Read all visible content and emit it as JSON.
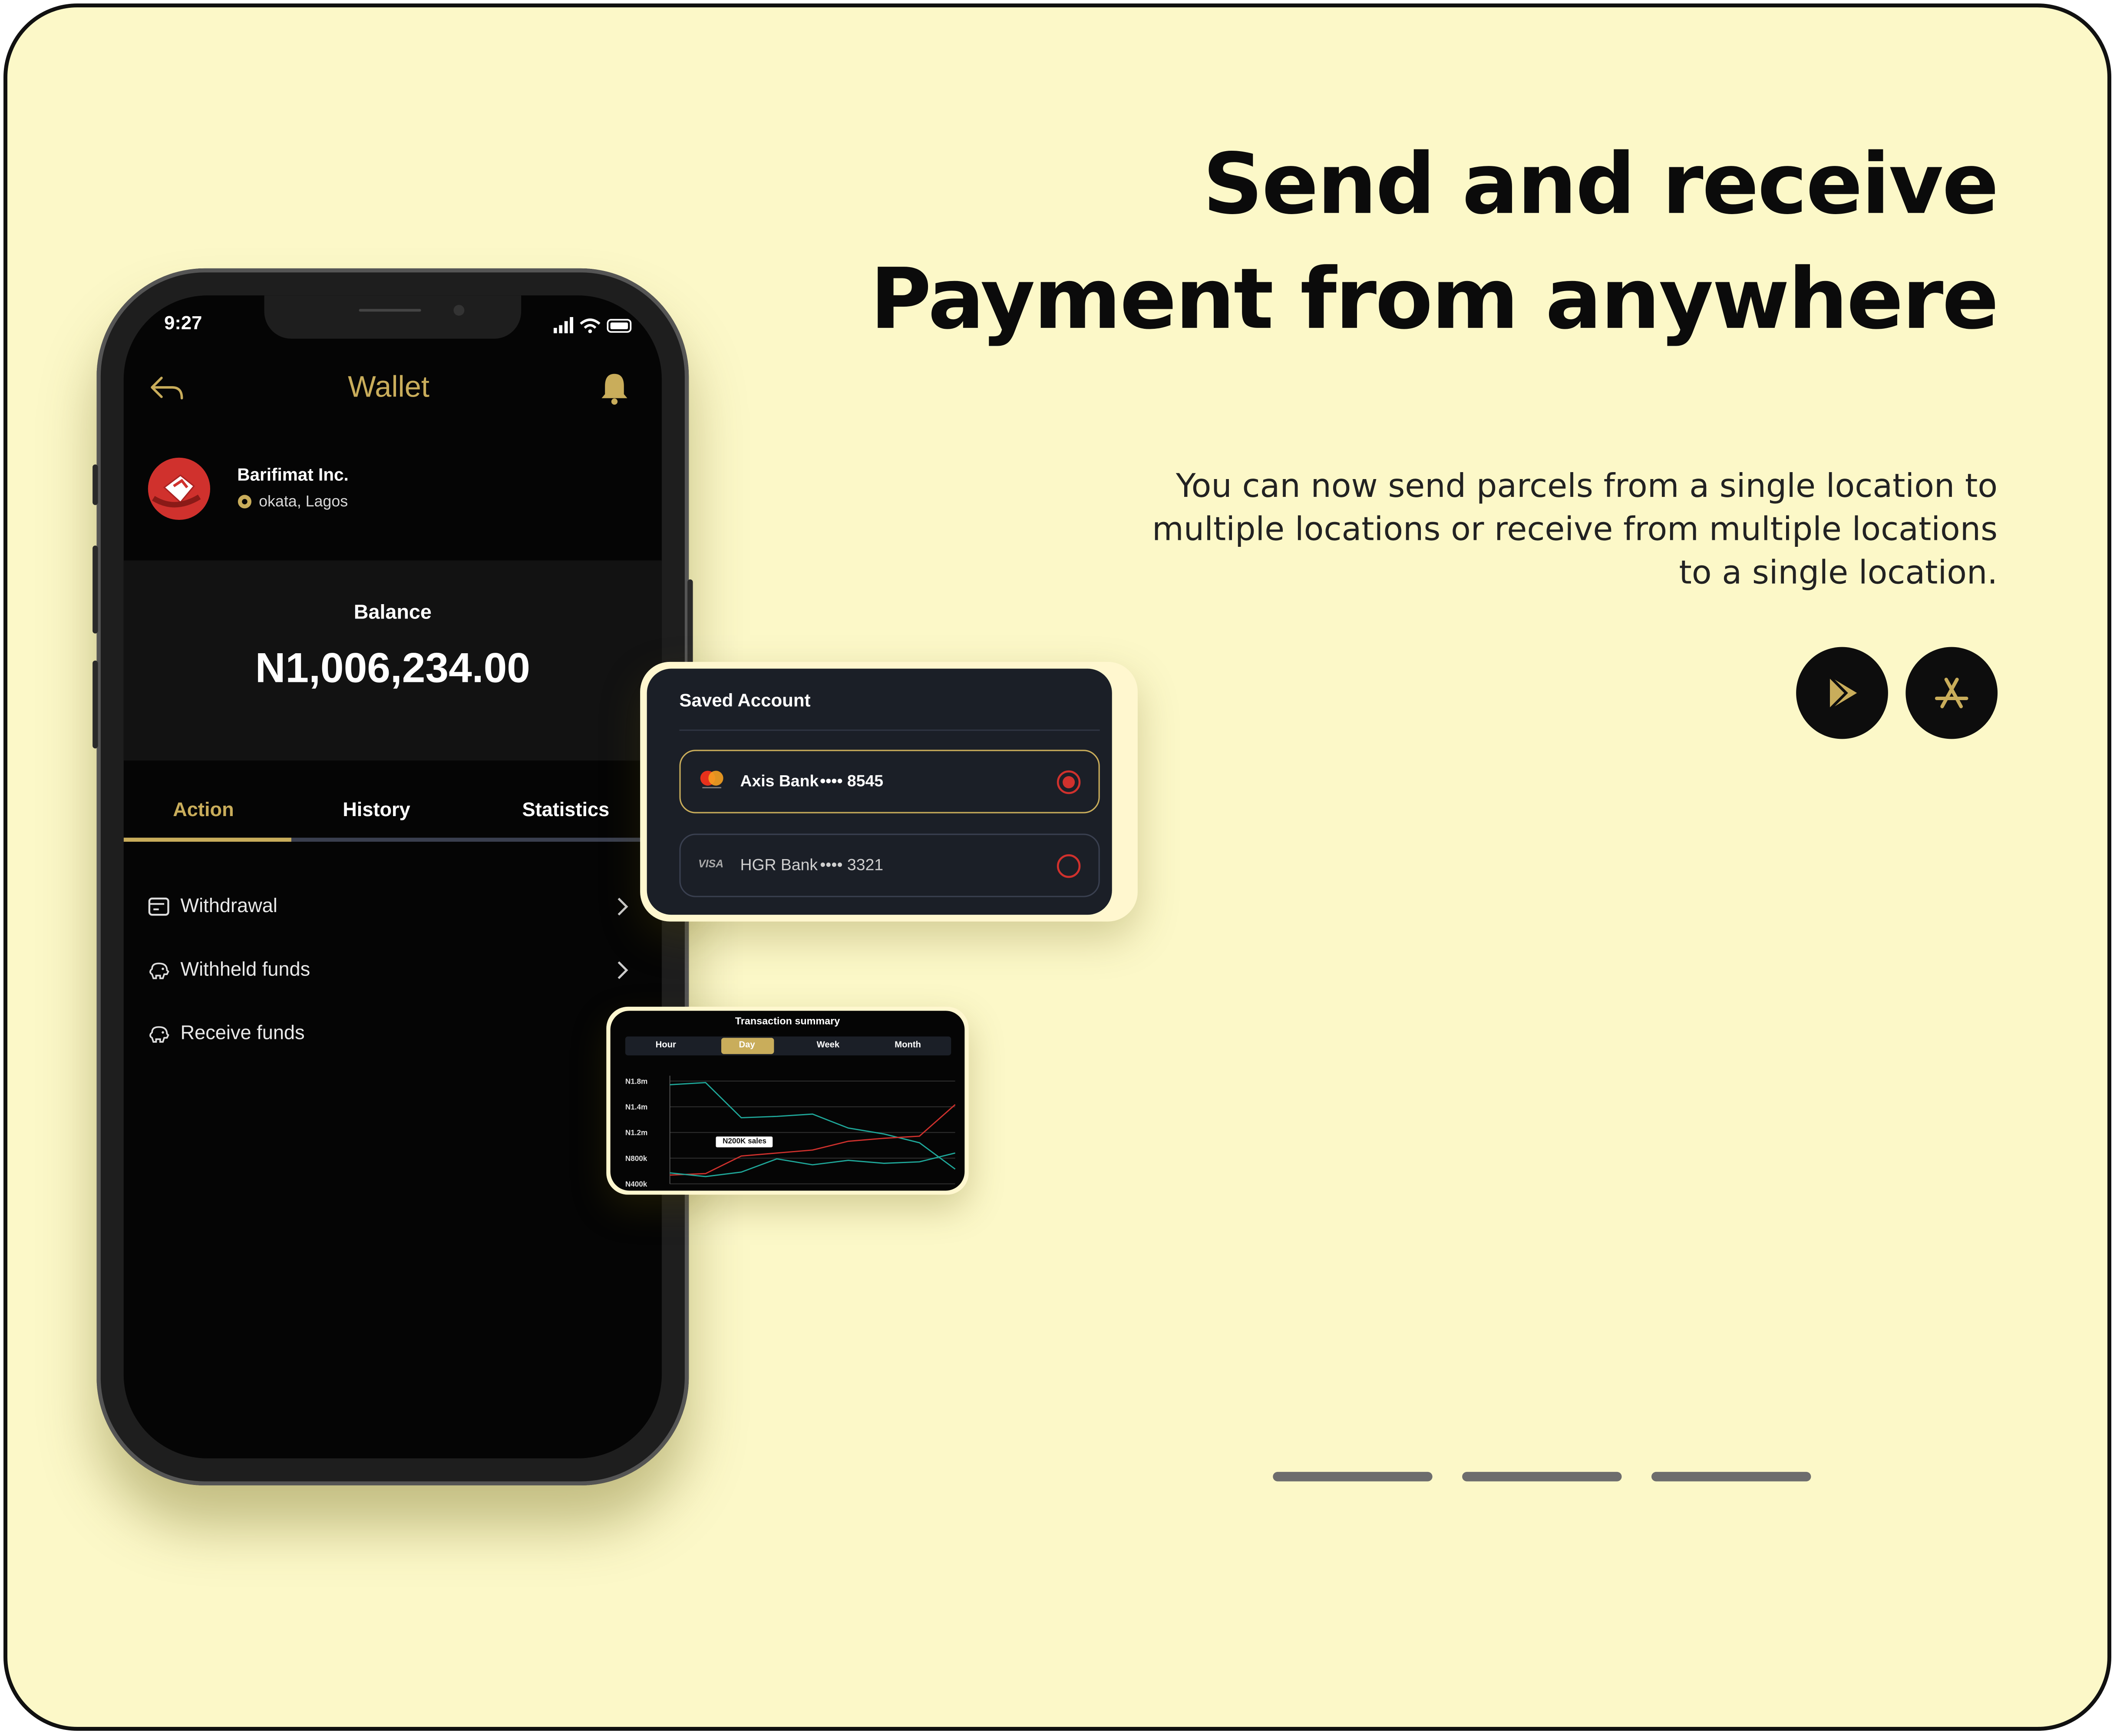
{
  "hero": {
    "title_line1": "Send and receive",
    "title_line2": "Payment from anywhere",
    "description": "You can now send parcels from a single location to multiple locations or receive from multiple locations to a single location."
  },
  "store_buttons": [
    {
      "icon": "google-play-icon"
    },
    {
      "icon": "app-store-icon"
    }
  ],
  "carousel": {
    "count": 3,
    "active_index": 0
  },
  "phone": {
    "status_time": "9:27",
    "header_title": "Wallet",
    "business_name": "Barifimat Inc.",
    "location": "okata, Lagos",
    "balance_label": "Balance",
    "balance_value": "N1,006,234.00",
    "tabs": [
      "Action",
      "History",
      "Statistics"
    ],
    "active_tab": 0,
    "actions": [
      "Withdrawal",
      "Withheld funds",
      "Receive funds"
    ]
  },
  "saved_account": {
    "title": "Saved Account",
    "accounts": [
      {
        "bank": "Axis Bank",
        "mask": "•••• 8545",
        "brand": "mastercard-icon",
        "selected": true
      },
      {
        "bank": "HGR Bank",
        "mask": "•••• 3321",
        "brand": "VISA",
        "selected": false
      }
    ]
  },
  "transaction_summary": {
    "title": "Transaction summary",
    "periods": [
      "Hour",
      "Day",
      "Week",
      "Month"
    ],
    "active_period": 1,
    "tooltip": "N200K sales"
  },
  "chart_data": {
    "type": "line",
    "title": "Transaction summary",
    "y_ticks": [
      "N1.8m",
      "N1.4m",
      "N1.2m",
      "N800k",
      "N400k"
    ],
    "x": [
      0,
      1,
      2,
      3,
      4,
      5,
      6,
      7,
      8
    ],
    "series": [
      {
        "color": "#1fa89a",
        "values": [
          1.75,
          1.78,
          1.3,
          1.32,
          1.35,
          1.16,
          1.08,
          0.96,
          0.6
        ]
      },
      {
        "color": "#d0312d",
        "values": [
          0.52,
          0.54,
          0.78,
          0.82,
          0.86,
          0.98,
          1.02,
          1.05,
          1.48
        ]
      },
      {
        "color": "#1fa89a",
        "values": [
          0.55,
          0.5,
          0.56,
          0.74,
          0.66,
          0.72,
          0.68,
          0.7,
          0.82
        ]
      }
    ],
    "ylim": [
      0.4,
      1.8
    ],
    "grid": true,
    "colors": {
      "accent": "#c9ad5b",
      "background": "#050505"
    }
  },
  "colors": {
    "page_bg": "#fcf8c8",
    "gold": "#c9ad5b",
    "red": "#d0312d"
  }
}
